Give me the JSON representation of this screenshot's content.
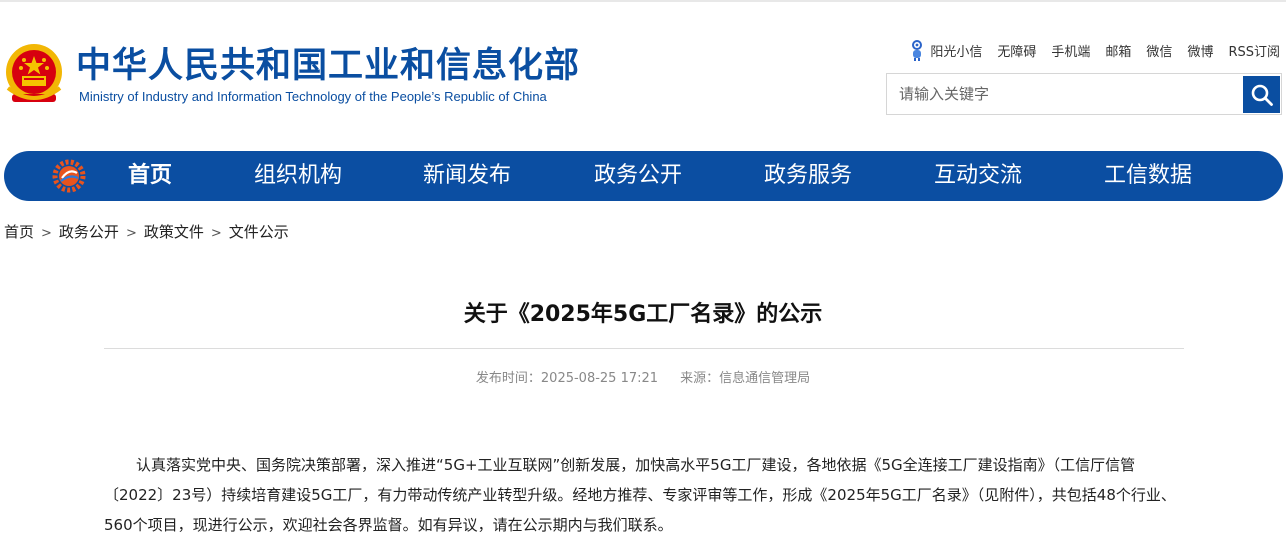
{
  "header": {
    "site_title": "中华人民共和国工业和信息化部",
    "site_subtitle": "Ministry of Industry and Information Technology of the People’s Republic of China",
    "logo_icon": "national-emblem-icon",
    "top_links": [
      "阳光小信",
      "无障碍",
      "手机端",
      "邮箱",
      "微信",
      "微博",
      "RSS订阅"
    ],
    "search": {
      "placeholder": "请输入关键字",
      "button_icon": "search-icon"
    }
  },
  "nav": {
    "logo_icon": "miit-gear-logo-icon",
    "items": [
      "首页",
      "组织机构",
      "新闻发布",
      "政务公开",
      "政务服务",
      "互动交流",
      "工信数据"
    ],
    "active": "首页"
  },
  "breadcrumb": {
    "items": [
      "首页",
      "政务公开",
      "政策文件",
      "文件公示"
    ],
    "separator": ">"
  },
  "article": {
    "title": "关于《2025年5G工厂名录》的公示",
    "meta_time_label": "发布时间：2025-08-25 17:21",
    "meta_source_label": "来源：信息通信管理局",
    "paragraph": "认真落实党中央、国务院决策部署，深入推进“5G+工业互联网”创新发展，加快高水平5G工厂建设，各地依据《5G全连接工厂建设指南》（工信厅信管〔2022〕23号）持续培育建设5G工厂，有力带动传统产业转型升级。经地方推荐、专家评审等工作，形成《2025年5G工厂名录》（见附件），共包括48个行业、560个项目，现进行公示，欢迎社会各界监督。如有异议，请在公示期内与我们联系。"
  },
  "colors": {
    "brand_blue": "#0b4ea2",
    "emblem_red": "#d7000f",
    "emblem_gold": "#f5c400"
  }
}
